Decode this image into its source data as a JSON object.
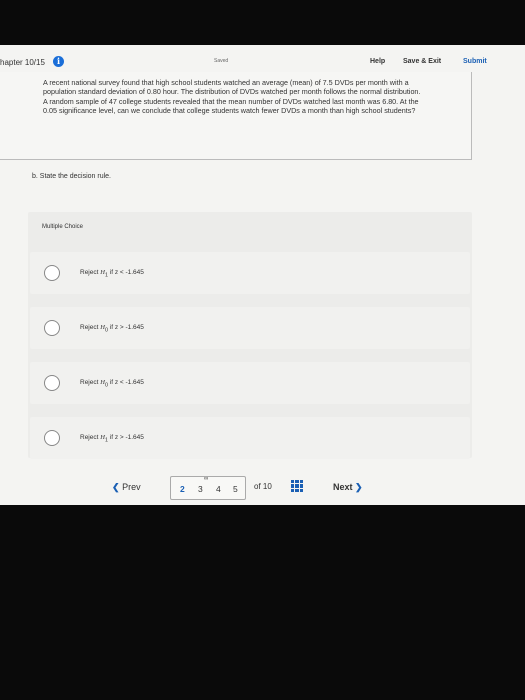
{
  "header": {
    "chapter": "hapter 10/15",
    "saved": "Saved",
    "help": "Help",
    "save_exit": "Save & Exit",
    "submit": "Submit"
  },
  "question": {
    "text": "A recent national survey found that high school students watched an average (mean) of 7.5 DVDs per month with a population standard deviation of 0.80 hour. The distribution of DVDs watched per month follows the normal distribution. A random sample of 47 college students revealed that the mean number of DVDs watched last month was 6.80. At the 0.05 significance level, can we conclude that college students watch fewer DVDs a month than high school students?"
  },
  "part_b": "b. State the decision rule.",
  "multiple_choice": {
    "label": "Multiple Choice",
    "options": [
      {
        "prefix": "Reject ",
        "h": "H",
        "sub": "1",
        "suffix": " if z < -1.645"
      },
      {
        "prefix": "Reject ",
        "h": "H",
        "sub": "0",
        "suffix": " if z > -1.645"
      },
      {
        "prefix": "Reject ",
        "h": "H",
        "sub": "0",
        "suffix": " if z < -1.645"
      },
      {
        "prefix": "Reject ",
        "h": "H",
        "sub": "1",
        "suffix": " if z > -1.645"
      }
    ]
  },
  "nav": {
    "prev": "Prev",
    "pages": [
      "2",
      "3",
      "4",
      "5"
    ],
    "current_page": "2",
    "of_total": "of 10",
    "next": "Next"
  },
  "icons": {
    "info": "info-icon",
    "link": "link-icon",
    "grid": "grid-icon",
    "prev_chevron": "chevron-left-icon",
    "next_chevron": "chevron-right-icon"
  },
  "colors": {
    "accent": "#1a5fb4",
    "info": "#1a6ed8"
  }
}
